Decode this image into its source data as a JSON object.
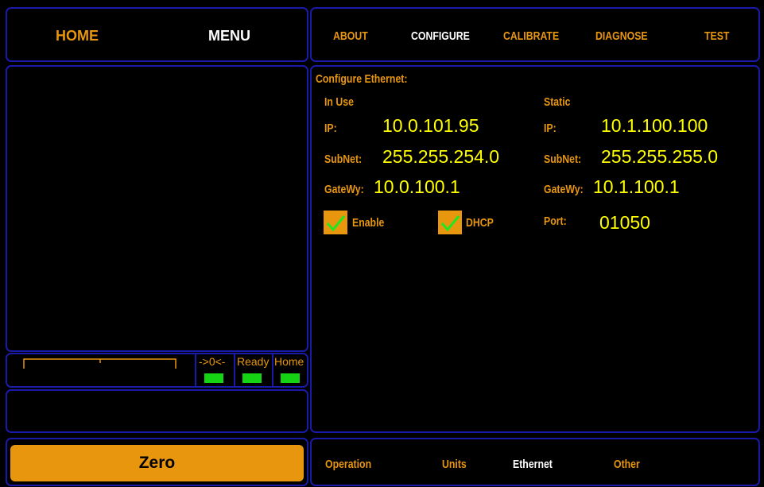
{
  "top_left_nav": {
    "home": "HOME",
    "menu": "MENU"
  },
  "top_right_nav": {
    "about": "ABOUT",
    "configure": "CONFIGURE",
    "calibrate": "CALIBRATE",
    "diagnose": "DIAGNOSE",
    "test": "TEST"
  },
  "configure": {
    "title": "Configure Ethernet:",
    "in_use": {
      "heading": "In Use",
      "ip_label": "IP:",
      "ip": "10.0.101.95",
      "subnet_label": "SubNet:",
      "subnet": "255.255.254.0",
      "gateway_label": "GateWy:",
      "gateway": "10.0.100.1"
    },
    "static": {
      "heading": "Static",
      "ip_label": "IP:",
      "ip": "10.1.100.100",
      "subnet_label": "SubNet:",
      "subnet": "255.255.255.0",
      "gateway_label": "GateWy:",
      "gateway": "10.1.100.1",
      "port_label": "Port:",
      "port": "01050"
    },
    "enable": {
      "label": "Enable",
      "checked": true
    },
    "dhcp": {
      "label": "DHCP",
      "checked": true
    }
  },
  "status": {
    "zero_label": "->0<-",
    "ready_label": "Ready",
    "home_label": "Home",
    "led_color": "#14d414"
  },
  "zero_button": "Zero",
  "bottom_tabs": {
    "operation": "Operation",
    "units": "Units",
    "ethernet": "Ethernet",
    "other": "Other"
  },
  "colors": {
    "accent": "#e8960e",
    "border": "#1a1aa8",
    "value": "#ffff00",
    "active": "#ffffff"
  }
}
